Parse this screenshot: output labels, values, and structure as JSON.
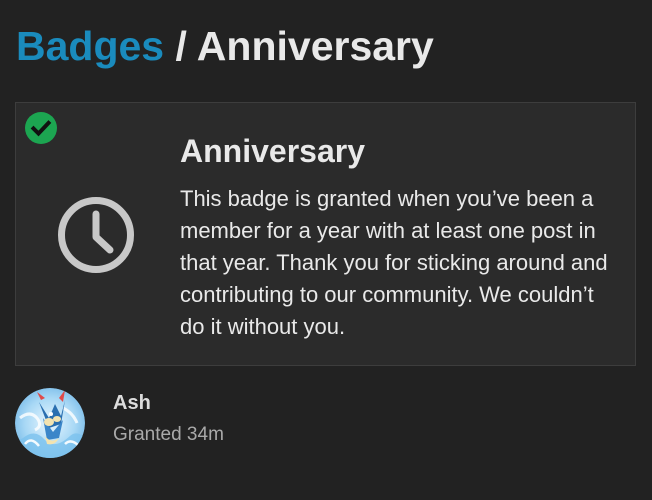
{
  "breadcrumb": {
    "parent_label": "Badges",
    "separator": "/",
    "current_label": "Anniversary"
  },
  "badge": {
    "title": "Anniversary",
    "description": "This badge is granted when you’ve been a member for a year with at least one post in that year. Thank you for sticking around and contributing to our community. We couldn’t do it without you.",
    "icon": "clock-icon",
    "granted_indicator_icon": "check-circle-icon"
  },
  "grant": {
    "username": "Ash",
    "granted_text": "Granted 34m",
    "avatar": "user-avatar"
  },
  "colors": {
    "background": "#222222",
    "link": "#1a8bbd",
    "text": "#e9e9e9",
    "muted_text": "#a9a9a9",
    "check_green": "#1ca551",
    "card_background": "#2b2b2b"
  }
}
